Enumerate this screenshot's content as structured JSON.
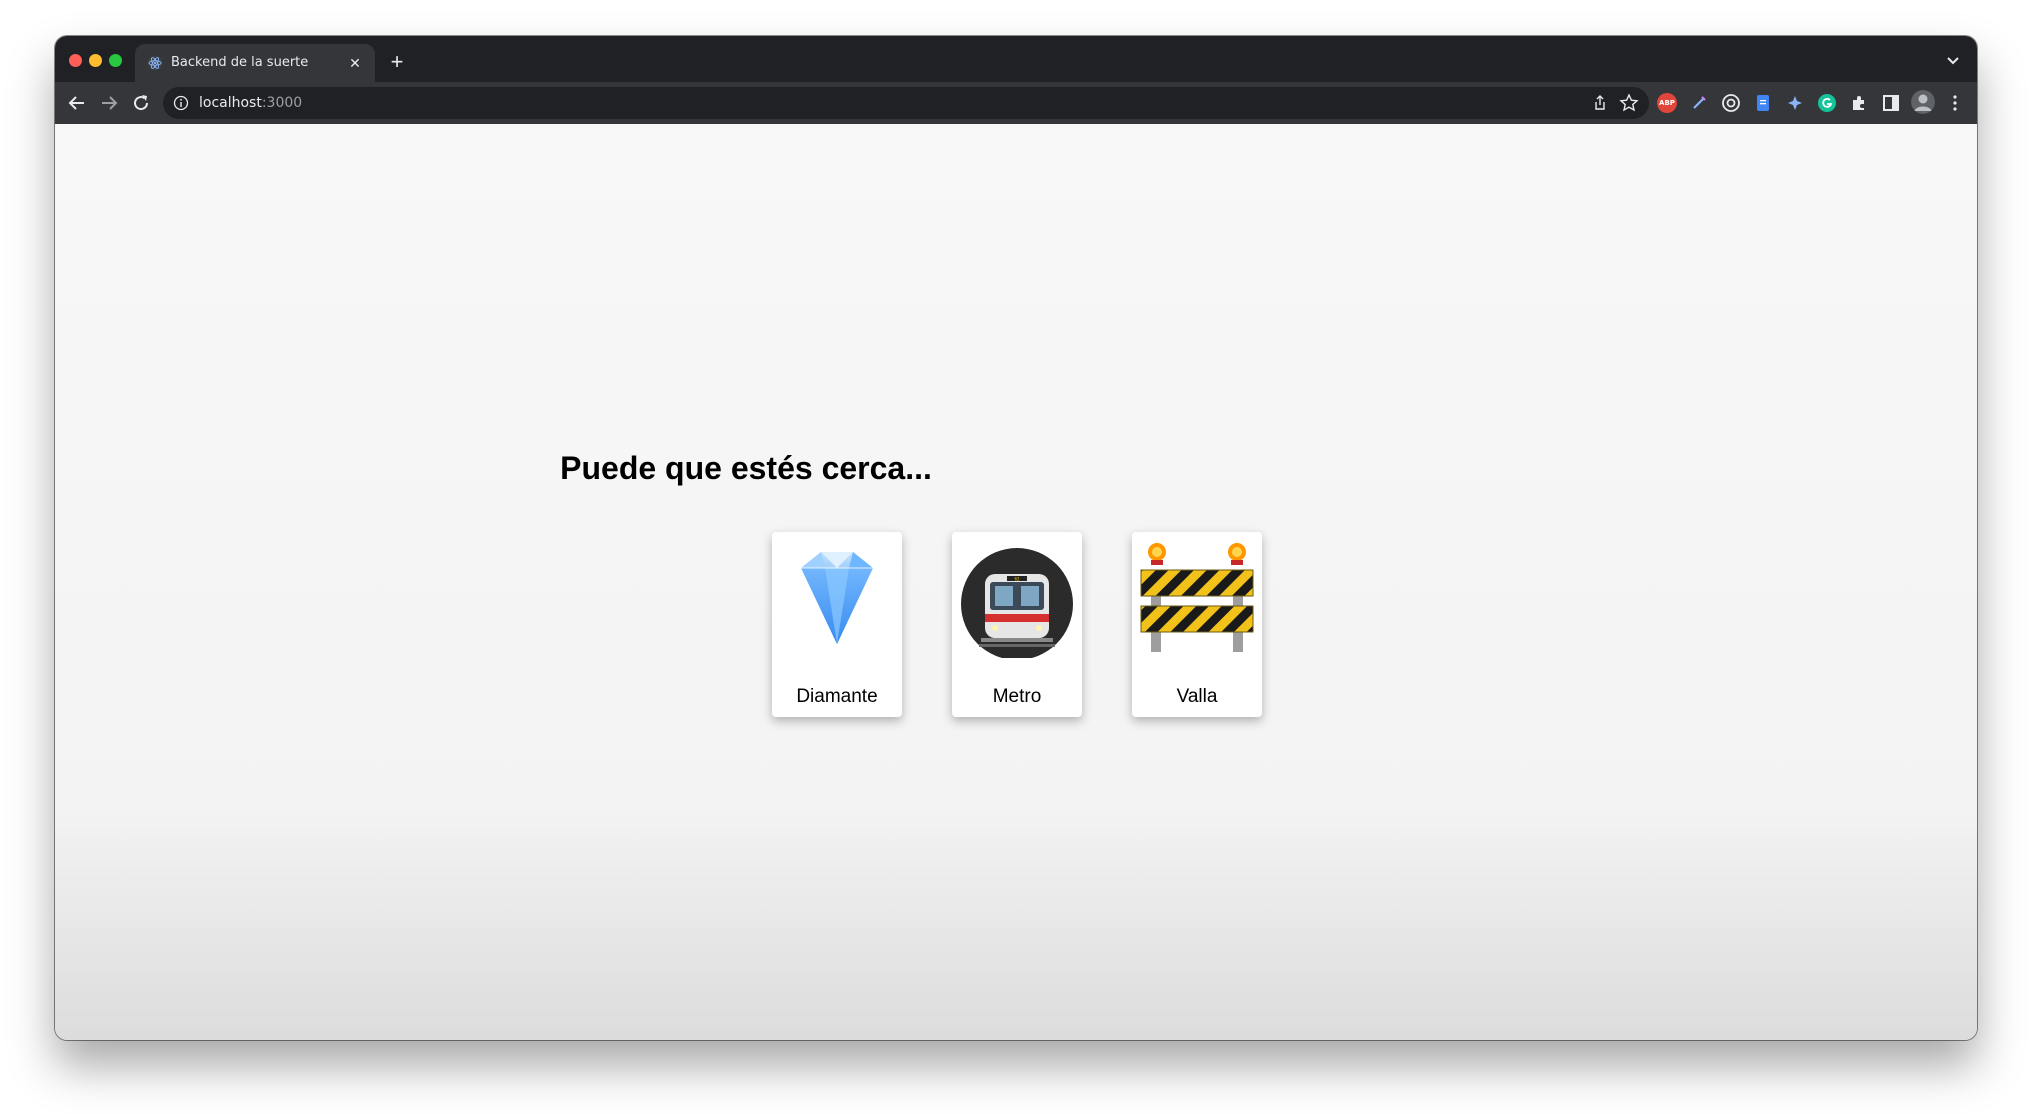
{
  "browser": {
    "tab": {
      "title": "Backend de la suerte",
      "favicon": "react-atom-icon"
    },
    "url": {
      "host": "localhost",
      "port": ":3000"
    },
    "extensions": [
      "adblock-plus-icon",
      "pen-icon",
      "browser-extension-icon",
      "document-icon",
      "puzzle-star-icon",
      "grammarly-icon",
      "extensions-puzzle-icon"
    ],
    "colors": {
      "frame": "#202124",
      "toolbar": "#35363a",
      "text": "#e8eaed"
    }
  },
  "page": {
    "heading": "Puede que estés cerca...",
    "cards": [
      {
        "label": "Diamante",
        "icon": "diamond-icon"
      },
      {
        "label": "Metro",
        "icon": "metro-train-icon"
      },
      {
        "label": "Valla",
        "icon": "construction-barrier-icon"
      }
    ]
  }
}
